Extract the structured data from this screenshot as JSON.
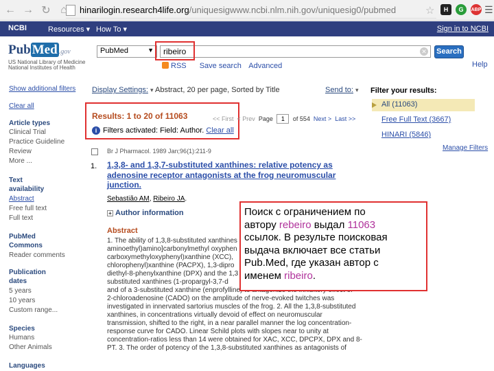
{
  "browser": {
    "url_host": "hinarilogin.research4life.org",
    "url_path": "/uniquesigwww.ncbi.nlm.nih.gov/uniquesig0/pubmed",
    "ext_h": "H",
    "ext_g": "G",
    "ext_abp": "ABP"
  },
  "ncbi": {
    "logo": "NCBI",
    "resources": "Resources",
    "howto": "How To",
    "signin": "Sign in to NCBI"
  },
  "pubmed": {
    "logo_pub": "Pub",
    "logo_med": "Med",
    "logo_gov": ".gov",
    "sub1": "US National Library of Medicine",
    "sub2": "National Institutes of Health",
    "db_selected": "PubMed",
    "search_value": "ribeiro",
    "search_button": "Search",
    "rss": "RSS",
    "save_search": "Save search",
    "advanced": "Advanced",
    "help": "Help"
  },
  "sidebar": {
    "show_filters": "Show additional filters",
    "clear_all": "Clear all",
    "article_types_h1": "Article types",
    "article_types": [
      "Clinical Trial",
      "Practice Guideline",
      "Review",
      "More ..."
    ],
    "text_avail_h1": "Text",
    "text_avail_h2": "availability",
    "text_avail": [
      "Abstract",
      "Free full text",
      "Full text"
    ],
    "commons_h1": "PubMed",
    "commons_h2": "Commons",
    "commons": [
      "Reader comments"
    ],
    "pubdates_h1": "Publication",
    "pubdates_h2": "dates",
    "pubdates": [
      "5 years",
      "10 years",
      "Custom range..."
    ],
    "species_h": "Species",
    "species": [
      "Humans",
      "Other Animals"
    ],
    "languages_h": "Languages"
  },
  "results": {
    "display_label": "Display Settings:",
    "display_value": "Abstract, 20 per page, Sorted by Title",
    "send_to": "Send to:",
    "title": "Results: 1 to 20 of 11063",
    "filters_text": "Filters activated: Field: Author.",
    "clear_all": "Clear all",
    "pager_first": "<< First",
    "pager_prev": "< Prev",
    "pager_page": "Page",
    "pager_current": "1",
    "pager_of": "of 554",
    "pager_next": "Next >",
    "pager_last": "Last >>"
  },
  "filter_panel": {
    "title": "Filter your results:",
    "all": "All (11063)",
    "free_full": "Free Full Text (3667)",
    "hinari": "HINARI (5846)",
    "manage": "Manage Filters"
  },
  "citation": {
    "source": "Br J Pharmacol. 1989 Jan;96(1):211-9",
    "number": "1.",
    "title_lines": [
      "1,3,8- and 1,3,7-substituted xanthines: relative potency as",
      "adenosine receptor antagonists at the frog neuromuscular",
      "junction."
    ],
    "author1": "Sebastião AM",
    "author2": "Ribeiro JA",
    "author_info": "Author information",
    "abstract_heading": "Abstract",
    "abstract_lines": [
      "1. The ability of 1,3,8-substituted xanthines",
      "aminoethyl)amino]carbonylmethyl oxyphen",
      "carboxymethyloxyphenyl)xanthine (XCC), ",
      "chlorophenyl)xanthine (PACPX), 1,3-dipro",
      "diethyl-8-phenylxanthine (DPX) and the 1,3",
      "substituted xanthines (1-propargyl-3,7-d",
      "and of a 3-substituted xanthine (enprofylline) to antagonize the inhibitory effect of",
      "2-chloroadenosine (CADO) on the amplitude of nerve-evoked twitches was",
      "investigated in innervated sartorius muscles of the frog. 2. All the 1,3,8-substituted",
      "xanthines, in concentrations virtually devoid of effect on neuromuscular",
      "transmission, shifted to the right, in a near parallel manner the log concentration-",
      "response curve for CADO. Linear Schild plots with slopes near to unity at",
      "concentration-ratios less than 14 were obtained for XAC, XCC, DPCPX, DPX and 8-",
      "PT. 3. The order of potency of the 1,3,8-substituted xanthines as antagonists of"
    ]
  },
  "note": {
    "l1": "Поиск с ограничением по",
    "l2_a": "автору ",
    "l2_b": "rebeiro",
    "l2_c": " выдал ",
    "l2_d": "11063",
    "l3": "ссылок.  В результе поисковая",
    "l4": "выдача включает все статьи",
    "l5": "Pub.Med, где указан автор с",
    "l6_a": "именем ",
    "l6_b": "ribeiro",
    "l6_c": "."
  },
  "colors": {
    "ncbi_bar": "#2f3f7f",
    "link": "#2b4ea8",
    "accent_red": "#e03030",
    "results_title": "#b54b1e",
    "highlight": "#b0329b"
  }
}
